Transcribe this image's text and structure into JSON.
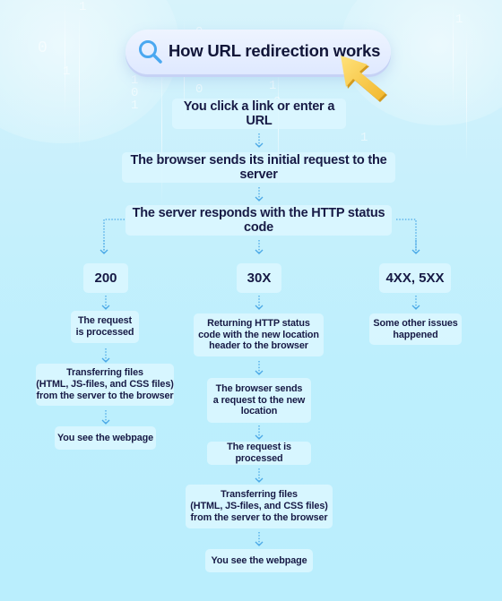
{
  "title": "How URL redirection works",
  "icons": {
    "search": "search-icon",
    "cursor": "cursor-arrow-icon",
    "arrow": "dotted-down-arrow-icon"
  },
  "colors": {
    "background": "#bdeffd",
    "box": "#dcf7ff",
    "text": "#14163f",
    "arrow": "#4aa8e6",
    "cursor": "#f7c948",
    "search_icon": "#4aa8f0"
  },
  "steps": {
    "start": "You click a link or enter a URL",
    "request": "The browser sends its initial request to the server",
    "response": "The server responds with the HTTP status code"
  },
  "branches": [
    {
      "code": "200",
      "steps": [
        "The request\nis processed",
        "Transferring files\n(HTML, JS-files, and CSS files)\nfrom the server to the browser",
        "You see the webpage"
      ]
    },
    {
      "code": "30X",
      "steps": [
        "Returning HTTP status\ncode with the new location\nheader to the browser",
        "The browser sends\na request to the new\nlocation",
        "The request is processed",
        "Transferring files\n(HTML, JS-files, and CSS files)\nfrom the server to the browser",
        "You see the webpage"
      ]
    },
    {
      "code": "4XX, 5XX",
      "steps": [
        "Some other issues\nhappened"
      ]
    }
  ]
}
